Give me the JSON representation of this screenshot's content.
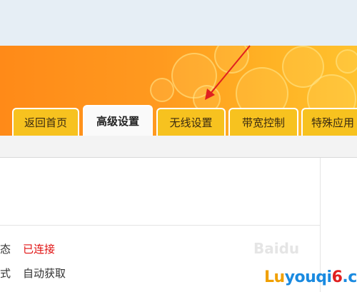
{
  "tabs": [
    {
      "label": "返回首页",
      "active": false
    },
    {
      "label": "高级设置",
      "active": true
    },
    {
      "label": "无线设置",
      "active": false
    },
    {
      "label": "带宽控制",
      "active": false
    },
    {
      "label": "特殊应用",
      "active": false
    }
  ],
  "status": [
    {
      "label": "态",
      "value": "已连接",
      "color": "#e01010"
    },
    {
      "label": "式",
      "value": "自动获取",
      "color": "#333333"
    }
  ],
  "watermark": {
    "part1": "Lu",
    "part2": "youqi",
    "part3": "6",
    "part4": ".cn",
    "baidu": "Baidu"
  },
  "colors": {
    "banner": "#ff9a1f",
    "tab": "#f7c21f",
    "arrow": "#e02020"
  }
}
